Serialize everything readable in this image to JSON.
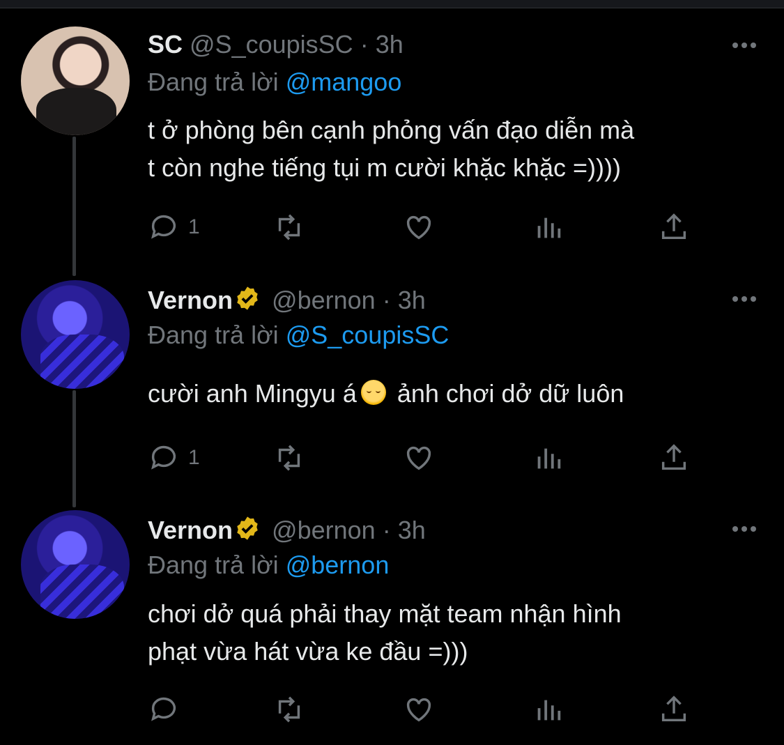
{
  "tweets": [
    {
      "name": "SC",
      "handle": "@S_coupisSC",
      "time": "· 3h",
      "verified": false,
      "reply_prefix": "Đang trả lời",
      "reply_to": "@mangoo",
      "lines": [
        "t ở phòng bên cạnh phỏng vấn đạo diễn mà",
        "t còn nghe tiếng tụi m cười khặc khặc =))))"
      ],
      "reply_count": "1"
    },
    {
      "name": "Vernon",
      "handle": "@bernon",
      "time": "· 3h",
      "verified": true,
      "reply_prefix": "Đang trả lời",
      "reply_to": "@S_coupisSC",
      "line_before_emoji": "cười anh Mingyu á",
      "emoji": "relieved-face-emoji",
      "line_after_emoji": " ảnh chơi dở dữ luôn",
      "reply_count": "1"
    },
    {
      "name": "Vernon",
      "handle": "@bernon",
      "time": "· 3h",
      "verified": true,
      "reply_prefix": "Đang trả lời",
      "reply_to": "@bernon",
      "lines": [
        "chơi dở quá phải thay mặt team nhận hình",
        "phạt vừa hát vừa ke đầu =)))"
      ],
      "reply_count": ""
    }
  ],
  "colors": {
    "background": "#000000",
    "text": "#e7e9ea",
    "muted": "#71767b",
    "link": "#1d9bf0",
    "badge": "#e2b719"
  }
}
